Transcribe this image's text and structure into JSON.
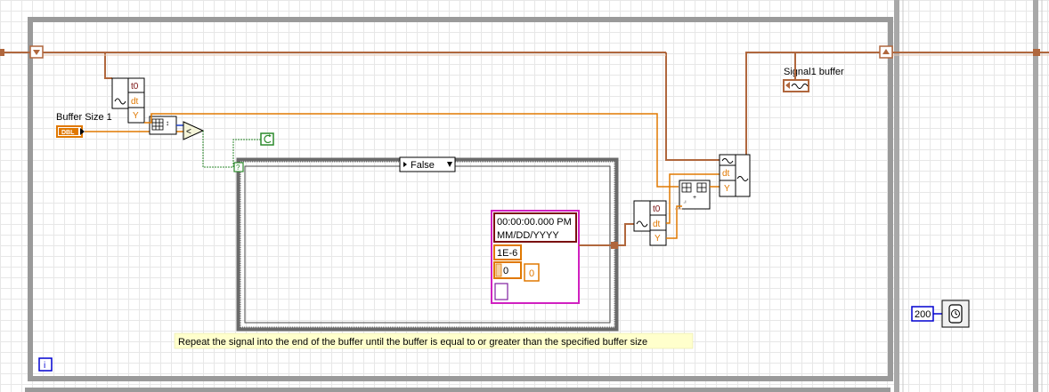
{
  "labels": {
    "buffer_size": "Buffer Size 1",
    "signal_buffer": "Signal1 buffer"
  },
  "case_selector": {
    "value": "False"
  },
  "bundle_top": {
    "t0": "t0",
    "dt": "dt",
    "y": "Y"
  },
  "bundle_mid": {
    "t0": "t0",
    "dt": "dt",
    "y": "Y"
  },
  "bundle_right": {
    "dt": "dt",
    "y": "Y"
  },
  "constants": {
    "dbl_terminal": "DBL",
    "timestamp_time": "00:00:00.000 PM",
    "timestamp_date": "MM/DD/YYYY",
    "dt_value": "1E-6",
    "y_index": "0",
    "y_value": "0",
    "wait_ms": "200"
  },
  "comment": "Repeat the signal into the end of the buffer until the buffer is equal to or greater than the specified buffer size",
  "info_icon": "i",
  "colors": {
    "wire_orange": "#e07800",
    "wire_maroon": "#b0673d",
    "loop_gray": "#909090",
    "cluster_pink": "#d020c0",
    "wire_green": "#2c8a2c",
    "int_blue": "#0000d0"
  }
}
